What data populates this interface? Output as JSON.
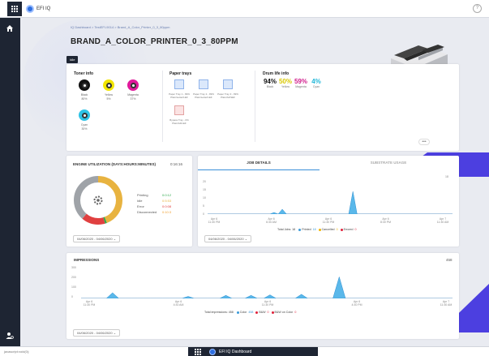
{
  "app": {
    "title": "EFI IQ",
    "help": "?"
  },
  "breadcrumb": "IQ Dashboard  >  TestEFI-9014  >  Brand_A_Color_Printer_0_3_80ppm",
  "page_title": "BRAND_A_COLOR_PRINTER_0_3_80PPM",
  "badge": "Idle",
  "toner": {
    "title": "Toner info",
    "items": [
      {
        "name": "Black",
        "pct": "80%",
        "color": "#111111"
      },
      {
        "name": "Yellow",
        "pct": "5%",
        "color": "#f2e600"
      },
      {
        "name": "Magenta",
        "pct": "37%",
        "color": "#e0199b"
      },
      {
        "name": "Cyan",
        "pct": "30%",
        "color": "#2ec3e6"
      }
    ]
  },
  "trays": {
    "title": "Paper trays",
    "items": [
      {
        "name": "Paper Tray 1 - 99%",
        "media": "Plain/Letter/LEF"
      },
      {
        "name": "Paper Tray 2 - 99%",
        "media": "Plain/Letter/LEF"
      },
      {
        "name": "Paper Tray 3 - 99%",
        "media": "Plain/A4/SEF"
      },
      {
        "name": "Bypass Tray - 0%",
        "media": "Plain/A4/LEF"
      }
    ]
  },
  "drum": {
    "title": "Drum life info",
    "items": [
      {
        "name": "Black",
        "pct": "94%",
        "color": "#111111"
      },
      {
        "name": "Yellow",
        "pct": "50%",
        "color": "#d9c800"
      },
      {
        "name": "Magenta",
        "pct": "59%",
        "color": "#d01c8b"
      },
      {
        "name": "Cyan",
        "pct": "4%",
        "color": "#1fb6d8"
      }
    ]
  },
  "more": "•••",
  "engine": {
    "title": "ENGINE UTILIZATION (DAYS:HOURS:MINUTES)",
    "total": "0:16:16",
    "legend": [
      {
        "name": "Printing",
        "value": "0:0:12",
        "color": "#2eaa4a"
      },
      {
        "name": "Idle",
        "value": "0:5:53",
        "color": "#e8b340"
      },
      {
        "name": "Error",
        "value": "0:0:08",
        "color": "#e04040"
      },
      {
        "name": "Disconnected",
        "value": "0:10:3",
        "color": "#f0a030"
      }
    ],
    "date_range": "04/06/2020 - 04/06/2020"
  },
  "jobs": {
    "tab_active": "JOB DETAILS",
    "tab_inactive": "SUBSTRATE USAGE",
    "max_label": "18",
    "y_ticks": [
      "20",
      "15",
      "10",
      "5",
      "0"
    ],
    "x_labels": [
      {
        "date": "Apr 6",
        "time": "11:30 PM"
      },
      {
        "date": "Apr 6",
        "time": "6:30 AM"
      },
      {
        "date": "Apr 6",
        "time": "11:30 PM"
      },
      {
        "date": "Apr 6",
        "time": "8:30 PM"
      },
      {
        "date": "Apr 7",
        "time": "11:30 AM"
      }
    ],
    "total": "Total Jobs: 18",
    "legend": [
      {
        "name": "Printed",
        "value": "18",
        "color": "#3a9ad9"
      },
      {
        "name": "Cancelled",
        "value": "0",
        "color": "#f0b400"
      },
      {
        "name": "Errored",
        "value": "0",
        "color": "#e0203a"
      }
    ],
    "date_range": "04/06/2020 - 04/06/2020",
    "series": [
      0,
      0,
      0,
      0,
      0,
      0,
      0,
      0,
      0,
      0,
      0,
      0,
      0,
      0,
      0,
      0,
      1,
      0,
      3,
      0,
      0,
      0,
      0,
      0,
      0,
      0,
      0,
      0,
      0,
      0,
      0,
      0,
      0,
      0,
      0,
      14,
      0,
      0,
      0,
      0,
      0,
      0,
      0,
      0,
      0,
      0,
      0,
      0,
      0,
      0,
      0,
      0,
      0,
      0,
      0,
      0,
      0,
      0,
      0,
      0
    ]
  },
  "impressions": {
    "title": "IMPRESSIONS",
    "max_label": "458",
    "y_ticks": [
      "300",
      "200",
      "100",
      "0"
    ],
    "x_labels": [
      {
        "date": "Apr 6",
        "time": "11:30 PM"
      },
      {
        "date": "Apr 6",
        "time": "4:30 AM"
      },
      {
        "date": "Apr 6",
        "time": "11:30 PM"
      },
      {
        "date": "Apr 6",
        "time": "4:30 PM"
      },
      {
        "date": "Apr 7",
        "time": "11:30 AM"
      }
    ],
    "total": "Total impressions: 458",
    "legend": [
      {
        "name": "Color",
        "value": "458",
        "color": "#3a9ad9"
      },
      {
        "name": "B&W",
        "value": "0",
        "color": "#e0203a"
      },
      {
        "name": "B&W on Color",
        "value": "0",
        "color": "#e0203a"
      }
    ],
    "date_range": "04/06/2020 - 04/06/2020",
    "series": [
      0,
      0,
      0,
      0,
      0,
      55,
      0,
      0,
      0,
      0,
      0,
      0,
      0,
      0,
      0,
      0,
      0,
      20,
      0,
      0,
      0,
      0,
      0,
      30,
      0,
      0,
      0,
      30,
      0,
      0,
      35,
      0,
      0,
      0,
      0,
      40,
      0,
      0,
      0,
      0,
      0,
      210,
      0,
      0,
      0,
      0,
      0,
      0,
      0,
      0,
      0,
      0,
      0,
      0,
      0,
      0,
      0,
      0,
      0,
      0
    ]
  },
  "status": "javascript:void(0);",
  "taskbar": {
    "label": "EFI IQ Dashboard"
  }
}
